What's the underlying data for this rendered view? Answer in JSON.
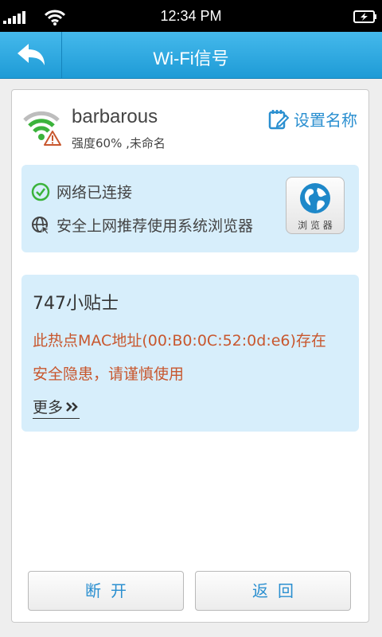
{
  "status_bar": {
    "time": "12:34 PM"
  },
  "header": {
    "title": "Wi-Fi信号"
  },
  "network": {
    "name": "barbarous",
    "details": "强度60% ,未命名",
    "rename_label": "设置名称"
  },
  "status_panel": {
    "connected_text": "网络已连接",
    "browser_tip": "安全上网推荐使用系统浏览器",
    "browser_button_label": "浏 览 器"
  },
  "tips": {
    "title": "747小贴士",
    "line1": "此热点MAC地址(00:B0:0C:52:0d:e6)存在",
    "line2": "安全隐患，请谨慎使用",
    "more_label": "更多"
  },
  "buttons": {
    "disconnect": "断开",
    "back": "返回"
  },
  "colors": {
    "title_bar": "#2aa6e0",
    "accent_blue": "#2a8fd0",
    "warning_text": "#c8572e",
    "panel_bg": "#d7eefb",
    "wifi_green": "#3bb33b"
  }
}
